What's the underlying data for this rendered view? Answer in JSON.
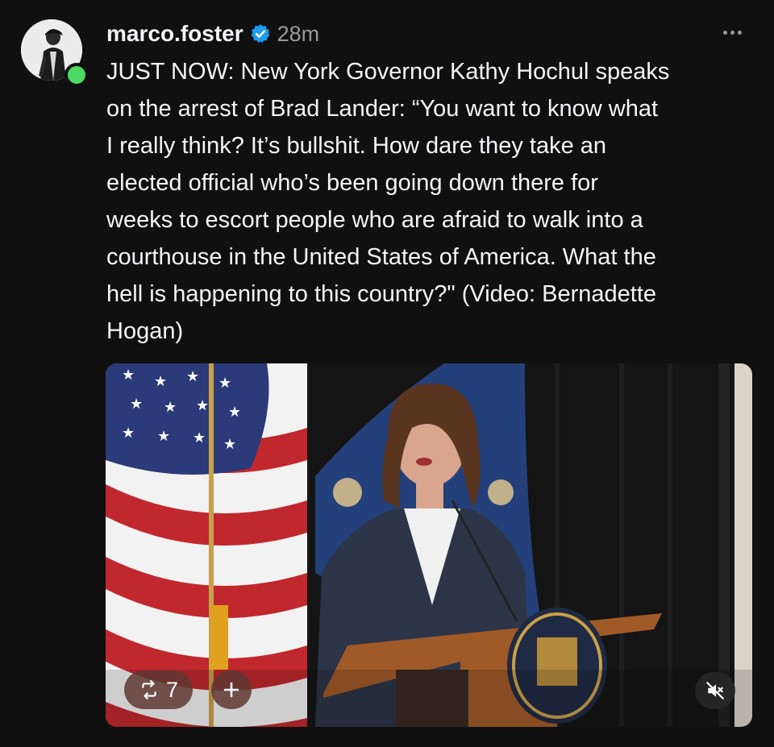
{
  "post": {
    "username": "marco.foster",
    "verified": true,
    "time": "28m",
    "lines": [
      "JUST NOW: New York Governor Kathy Hochul speaks",
      "on the arrest of Brad Lander: “You want to know what",
      "I really think? It’s bullshit. How dare they take an",
      "elected official who’s been going down there for",
      "weeks to escort people who are afraid to walk into a",
      "courthouse in the United States of America. What the",
      "hell is happening to this country?\" (Video: Bernadette",
      "Hogan)"
    ]
  },
  "media": {
    "repost_count": "7",
    "add_label": "+"
  },
  "icons": {
    "verified": "verified-badge-icon",
    "more": "more-options-icon",
    "repost": "repost-icon",
    "mute": "muted-speaker-icon"
  },
  "colors": {
    "background": "#101010",
    "text": "#f3f5f7",
    "secondary": "#9a9a9a",
    "verified": "#1d9bf0",
    "online": "#4cd964"
  }
}
